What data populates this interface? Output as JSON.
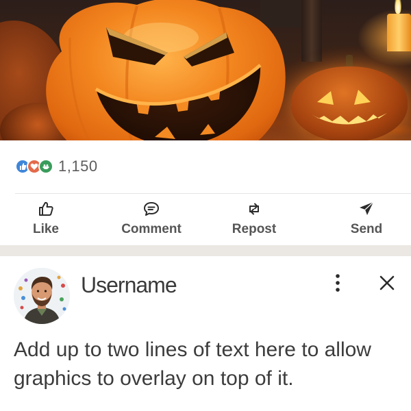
{
  "post": {
    "image_name": "halloween-pumpkins-image",
    "reactions": {
      "icons": [
        "like-reaction-icon",
        "love-reaction-icon",
        "support-reaction-icon"
      ],
      "count": "1,150"
    }
  },
  "actions": {
    "like": {
      "label": "Like",
      "icon": "thumbs-up-icon"
    },
    "comment": {
      "label": "Comment",
      "icon": "comment-bubble-icon"
    },
    "repost": {
      "label": "Repost",
      "icon": "repost-arrows-icon"
    },
    "send": {
      "label": "Send",
      "icon": "paper-plane-icon"
    }
  },
  "next_post": {
    "username": "Username",
    "text": "Add up to two lines of text here to allow graphics to overlay on top of it.",
    "more_icon": "more-vertical-icon",
    "close_icon": "close-icon"
  },
  "colors": {
    "action_text": "#555555",
    "divider": "#e4e4e4",
    "section_gap": "#ebe8e3",
    "pumpkin_orange": "#f07a1a"
  }
}
